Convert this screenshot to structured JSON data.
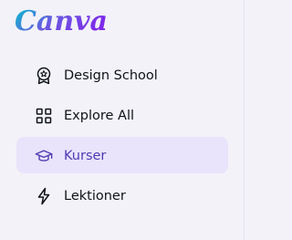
{
  "brand": {
    "name": "Canva"
  },
  "nav": {
    "items": [
      {
        "label": "Design School",
        "icon": "award-badge-icon",
        "active": false
      },
      {
        "label": "Explore All",
        "icon": "grid-icon",
        "active": false
      },
      {
        "label": "Kurser",
        "icon": "graduation-cap-icon",
        "active": true
      },
      {
        "label": "Lektioner",
        "icon": "lightning-bolt-icon",
        "active": false
      }
    ]
  },
  "colors": {
    "background": "#f3f2f8",
    "active_background": "#e9e3fb",
    "active_text": "#4e3bb0",
    "text": "#0e1318",
    "logo_start": "#00c4cc",
    "logo_mid": "#6a5ae0",
    "logo_end": "#7d2ae8"
  }
}
